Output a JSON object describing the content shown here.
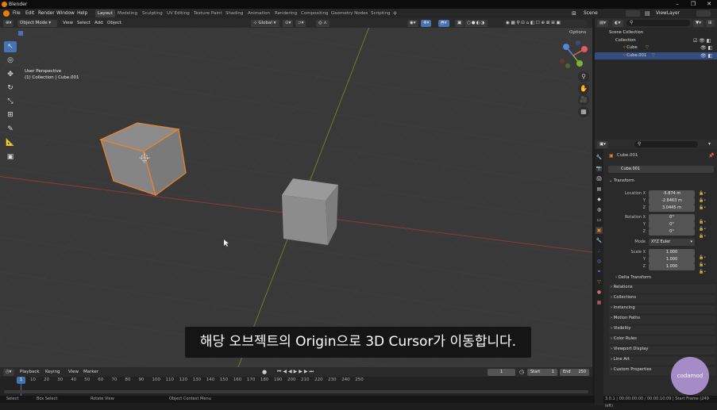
{
  "window": {
    "title": "Blender"
  },
  "topbar": {
    "menus": [
      "File",
      "Edit",
      "Render",
      "Window",
      "Help"
    ],
    "workspaces": [
      "Layout",
      "Modeling",
      "Sculpting",
      "UV Editing",
      "Texture Paint",
      "Shading",
      "Animation",
      "Rendering",
      "Compositing",
      "Geometry Nodes",
      "Scripting"
    ],
    "active_workspace": "Layout",
    "scene": "Scene",
    "view_layer": "ViewLayer"
  },
  "viewport_header": {
    "mode": "Object Mode",
    "menus": [
      "View",
      "Select",
      "Add",
      "Object"
    ],
    "orientation": "Global",
    "options": "Options"
  },
  "viewport": {
    "perspective": "User Perspective",
    "collection_info": "(1) Collection | Cube.001"
  },
  "subtitle": "해당 오브젝트의 Origin으로 3D Cursor가 이동합니다.",
  "timeline": {
    "menus": [
      "Playback",
      "Keying",
      "View",
      "Marker"
    ],
    "current_frame": "1",
    "start_label": "Start",
    "start": "1",
    "end_label": "End",
    "end": "250",
    "ticks": [
      "10",
      "20",
      "30",
      "40",
      "50",
      "60",
      "70",
      "80",
      "90",
      "100",
      "110",
      "120",
      "130",
      "140",
      "150",
      "160",
      "170",
      "180",
      "190",
      "200",
      "210",
      "220",
      "230",
      "240",
      "250"
    ],
    "playhead": "1"
  },
  "statusbar": {
    "items": [
      "Select",
      "Box Select",
      "Rotate View",
      "Object Context Menu"
    ],
    "version": "3.0.1 | 00:00:00:00 / 00:00:10:09 | Start Frame (249 left)"
  },
  "outliner": {
    "root": "Scene Collection",
    "rows": [
      "Collection",
      "Cube",
      "Cube.001"
    ]
  },
  "properties": {
    "object_name": "Cube.001",
    "data_name": "Cube.001",
    "transform_label": "Transform",
    "location": {
      "label": "Location X",
      "x": "-5.874 m",
      "y": "-2.8463 m",
      "z": "3.0445 m"
    },
    "rotation": {
      "label": "Rotation X",
      "x": "0°",
      "y": "0°",
      "z": "0°"
    },
    "mode_label": "Mode",
    "mode": "XYZ Euler",
    "scale": {
      "label": "Scale X",
      "x": "1.000",
      "y": "1.000",
      "z": "1.000"
    },
    "axis_y": "Y",
    "axis_z": "Z",
    "delta": "Delta Transform",
    "sections": [
      "Relations",
      "Collections",
      "Instancing",
      "Motion Paths",
      "Visibility",
      "Color Rules",
      "Viewport Display",
      "Line Art",
      "Custom Properties"
    ]
  },
  "watermark": "codamod"
}
